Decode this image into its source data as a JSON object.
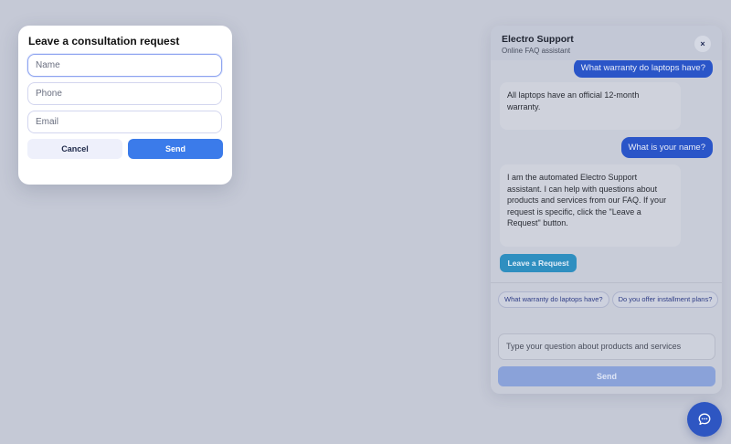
{
  "modal": {
    "title": "Leave a consultation request",
    "name_placeholder": "Name",
    "phone_placeholder": "Phone",
    "email_placeholder": "Email",
    "cancel_label": "Cancel",
    "send_label": "Send"
  },
  "chat": {
    "title": "Electro Support",
    "subtitle": "Online FAQ assistant",
    "close_icon": "×",
    "messages": [
      {
        "role": "user",
        "text": "What warranty do laptops have?"
      },
      {
        "role": "bot",
        "text": "All laptops have an official 12-month warranty."
      },
      {
        "role": "user",
        "text": "What is your name?"
      },
      {
        "role": "bot",
        "text": "I am the automated Electro Support assistant. I can help with questions about products and services from our FAQ. If your request is specific, click the \"Leave a Request\" button."
      }
    ],
    "leave_request_label": "Leave a Request",
    "suggestions": [
      "What warranty do laptops have?",
      "Do you offer installment plans?"
    ],
    "input_placeholder": "Type your question about products and services",
    "send_label": "Send"
  },
  "fab": {
    "icon": "chat-bubble-icon"
  },
  "colors": {
    "accent": "#3b7bea",
    "chat_blue": "#2a55c8",
    "overlay": "#c5c9d6"
  }
}
